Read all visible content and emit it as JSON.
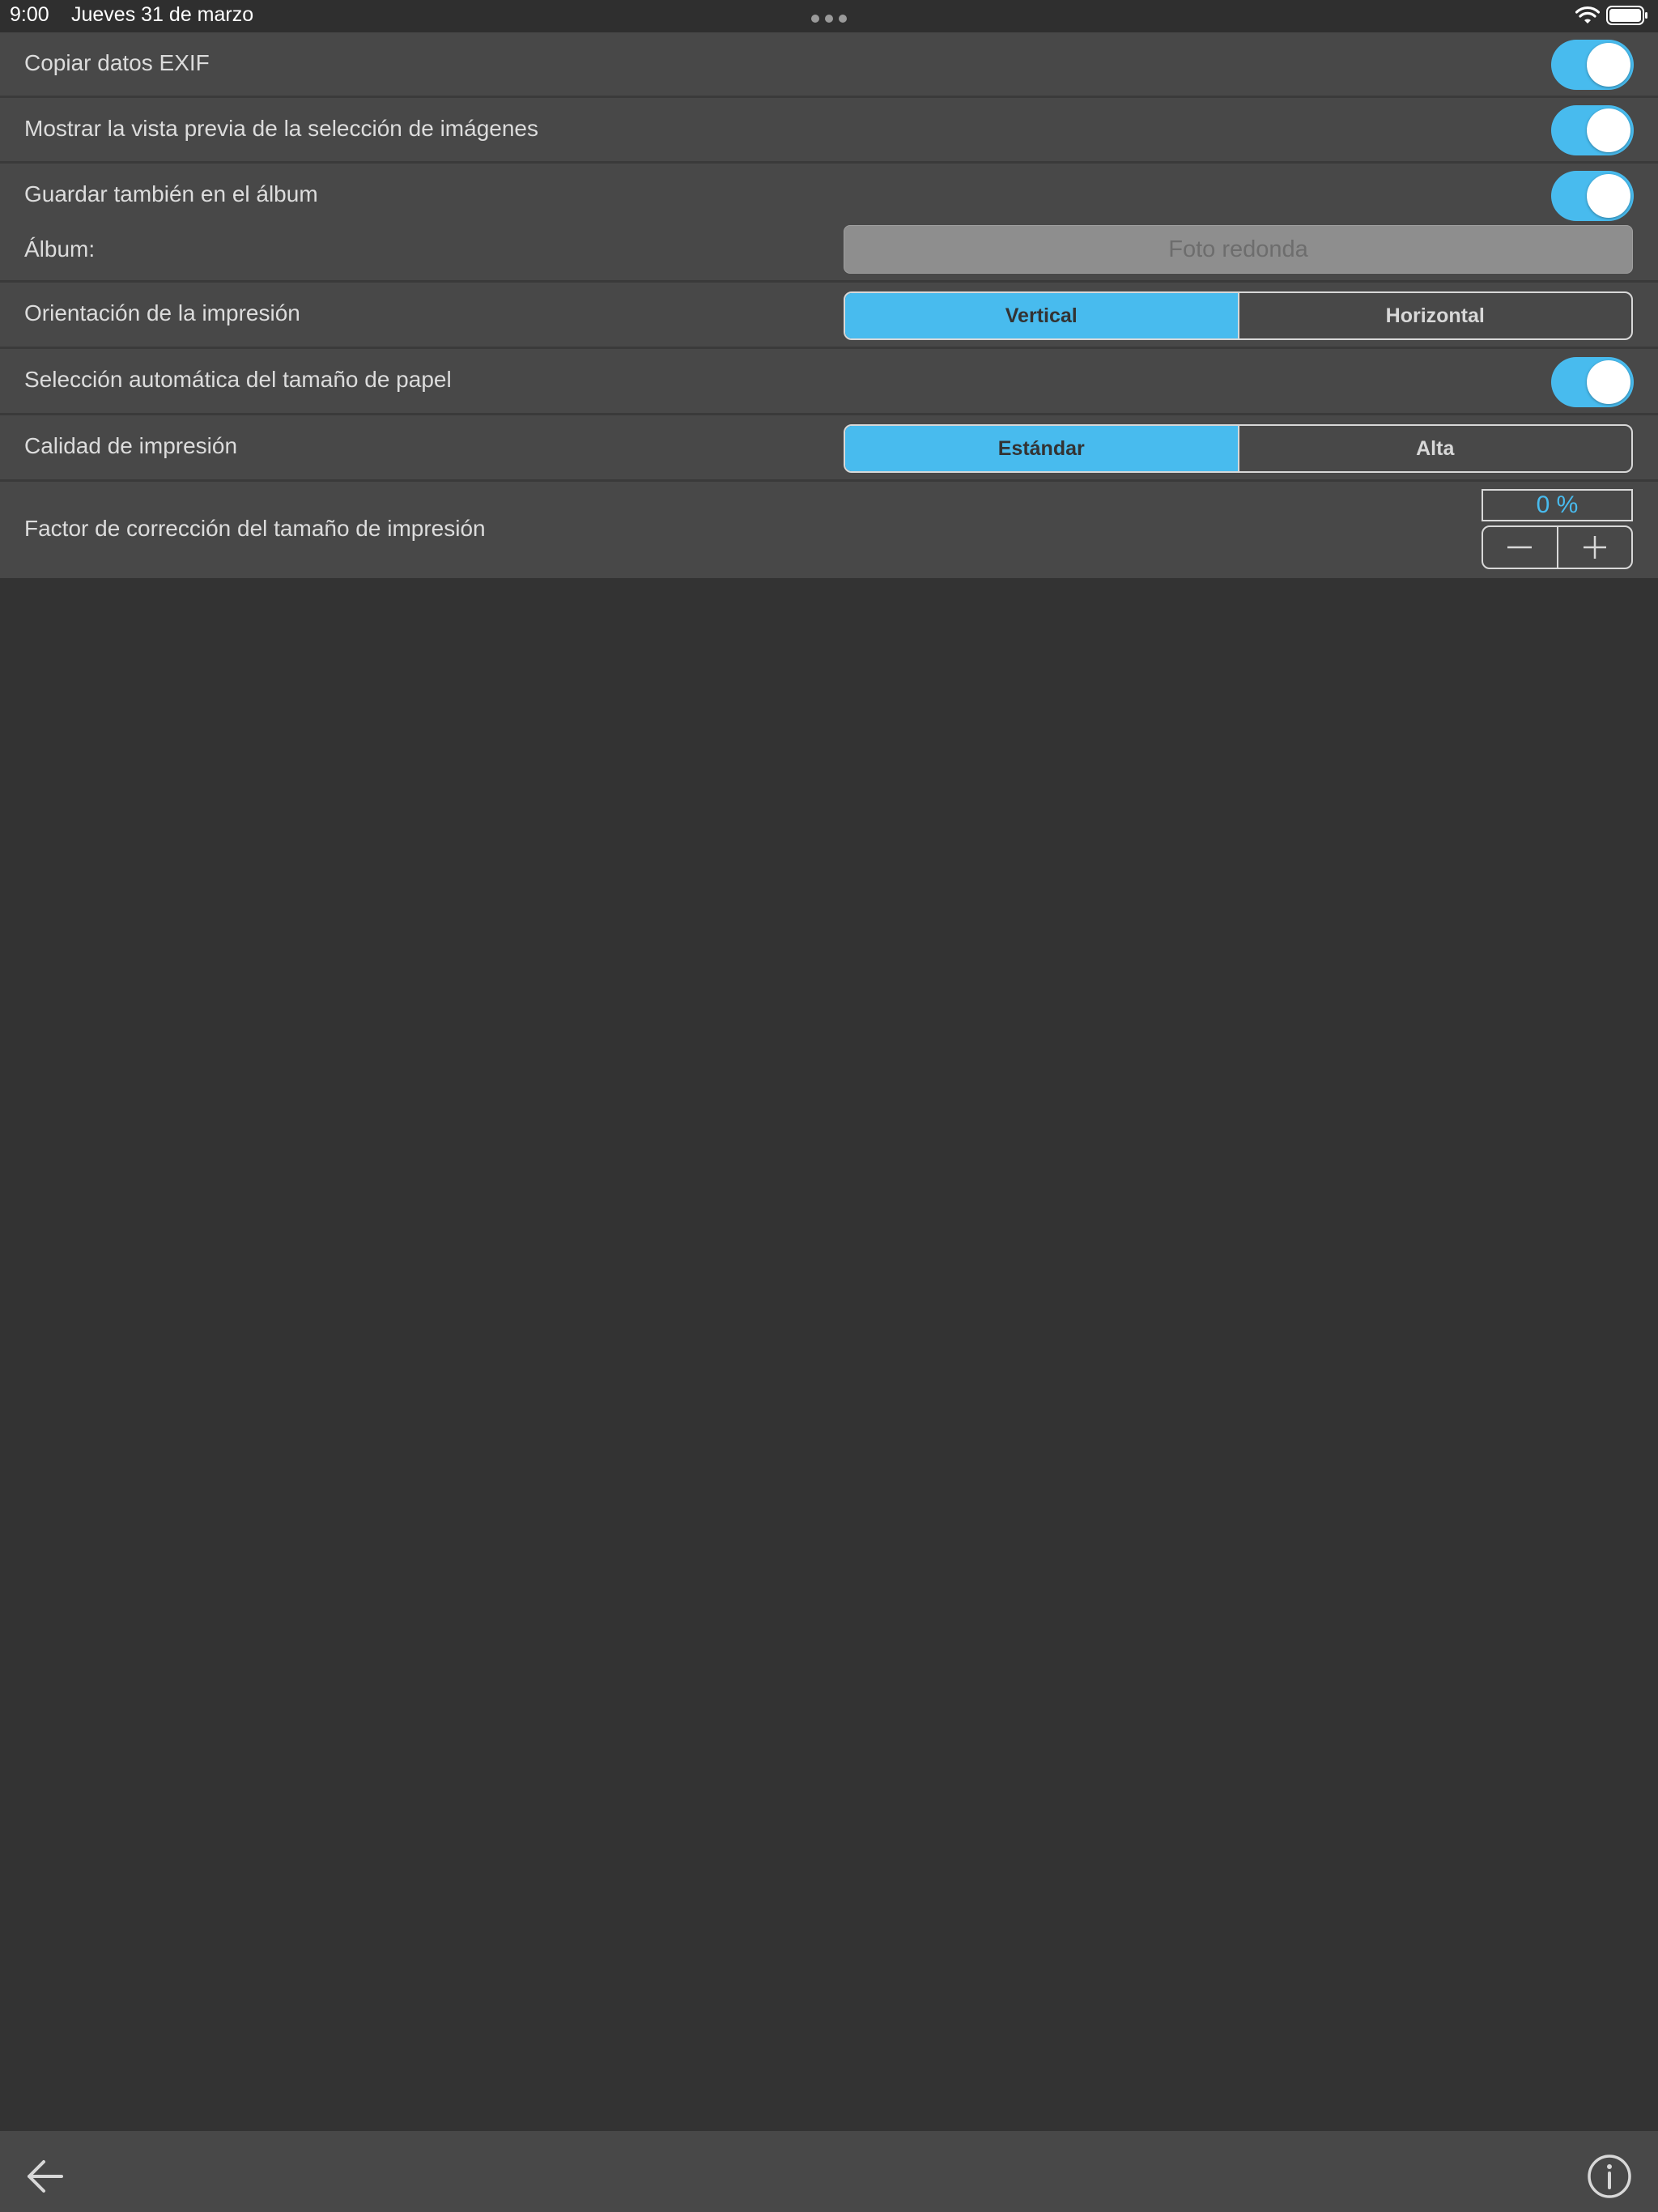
{
  "status_bar": {
    "time": "9:00",
    "date": "Jueves 31 de marzo",
    "icons": [
      "multitask-dots-icon",
      "wifi-icon",
      "battery-icon"
    ]
  },
  "settings": {
    "copy_exif": {
      "label": "Copiar datos EXIF",
      "on": true
    },
    "show_preview": {
      "label": "Mostrar la vista previa de la selección de imágenes",
      "on": true
    },
    "save_album": {
      "label": "Guardar también en el álbum",
      "on": true
    },
    "album": {
      "label": "Álbum:",
      "placeholder": "Foto redonda",
      "value": ""
    },
    "orientation": {
      "label": "Orientación de la impresión",
      "options": [
        "Vertical",
        "Horizontal"
      ],
      "selected": "Vertical"
    },
    "auto_paper": {
      "label": "Selección automática del tamaño de papel",
      "on": true
    },
    "quality": {
      "label": "Calidad de impresión",
      "options": [
        "Estándar",
        "Alta"
      ],
      "selected": "Estándar"
    },
    "size_correction": {
      "label": "Factor de corrección del tamaño de impresión",
      "value": "0 %",
      "decrement_icon": "minus-icon",
      "increment_icon": "plus-icon"
    }
  },
  "toolbar": {
    "back_icon": "arrow-left-icon",
    "info_icon": "info-icon"
  },
  "colors": {
    "accent": "#48bbee",
    "background": "#333333",
    "row_background": "#484848",
    "text": "#dcdcdc"
  }
}
